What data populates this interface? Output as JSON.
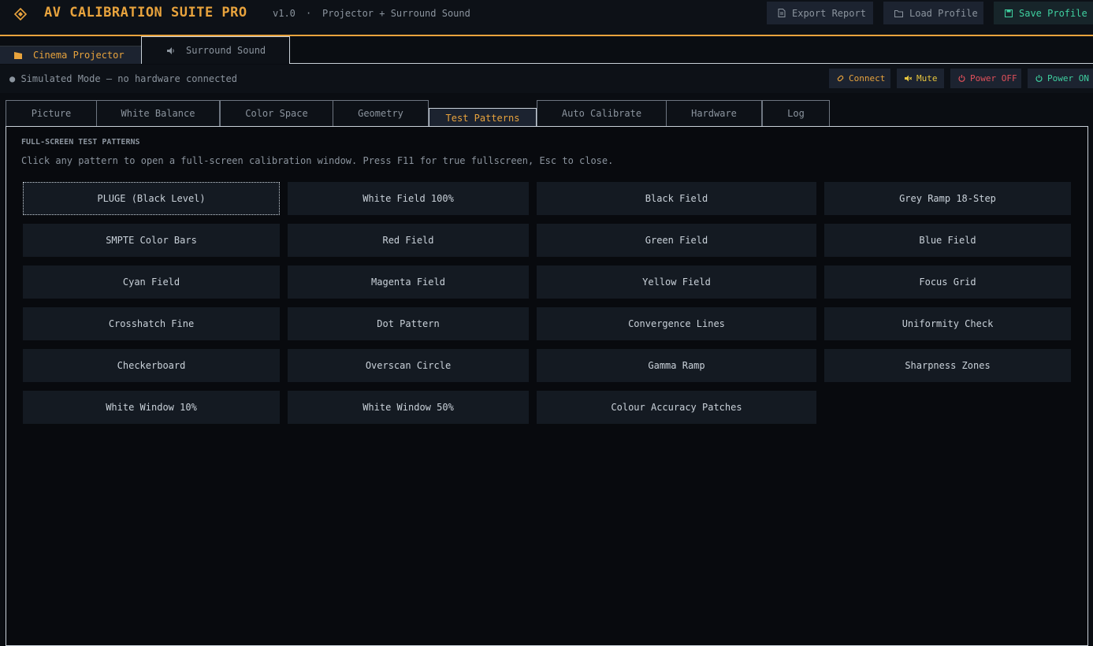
{
  "header": {
    "title": "AV CALIBRATION SUITE PRO",
    "version": "v1.0",
    "separator": "·",
    "subtitle": "Projector + Surround Sound",
    "buttons": {
      "export": "Export Report",
      "load": "Load Profile",
      "save": "Save Profile"
    }
  },
  "device_tabs": [
    {
      "label": "Cinema Projector",
      "icon": "projector-icon",
      "active": true
    },
    {
      "label": "Surround Sound",
      "icon": "speaker-icon",
      "active": false
    }
  ],
  "status": {
    "text": "● Simulated Mode — no hardware connected",
    "buttons": {
      "connect": "Connect",
      "mute": "Mute",
      "power_off": "Power OFF",
      "power_on": "Power ON"
    }
  },
  "sub_tabs": [
    {
      "label": "Picture"
    },
    {
      "label": "White Balance"
    },
    {
      "label": "Color Space"
    },
    {
      "label": "Geometry"
    },
    {
      "label": "Test Patterns",
      "active": true
    },
    {
      "label": "Auto Calibrate"
    },
    {
      "label": "Hardware"
    },
    {
      "label": "Log"
    }
  ],
  "section": {
    "title": "FULL-SCREEN TEST PATTERNS",
    "description": "Click any pattern to open a full-screen calibration window. Press F11 for true fullscreen, Esc to close."
  },
  "patterns": [
    "PLUGE (Black Level)",
    "White Field 100%",
    "Black Field",
    "Grey Ramp 18-Step",
    "SMPTE Color Bars",
    "Red Field",
    "Green Field",
    "Blue Field",
    "Cyan Field",
    "Magenta Field",
    "Yellow Field",
    "Focus Grid",
    "Crosshatch Fine",
    "Dot Pattern",
    "Convergence Lines",
    "Uniformity Check",
    "Checkerboard",
    "Overscan Circle",
    "Gamma Ramp",
    "Sharpness Zones",
    "White Window 10%",
    "White Window 50%",
    "Colour Accuracy Patches"
  ],
  "colors": {
    "accent": "#e8a33d",
    "success": "#3fd0a0",
    "danger": "#e0505a",
    "warning": "#e8c63d",
    "background": "#0a0d12",
    "button": "#141a22"
  }
}
